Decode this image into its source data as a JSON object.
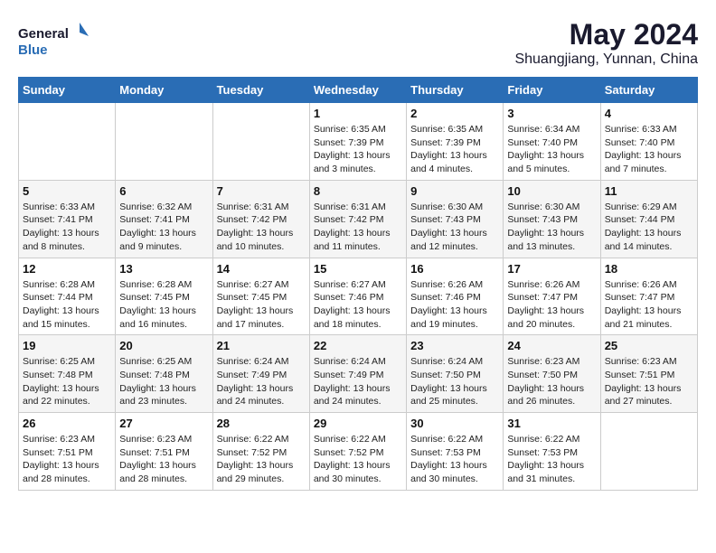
{
  "header": {
    "logo_line1": "General",
    "logo_line2": "Blue",
    "month_year": "May 2024",
    "location": "Shuangjiang, Yunnan, China"
  },
  "days_of_week": [
    "Sunday",
    "Monday",
    "Tuesday",
    "Wednesday",
    "Thursday",
    "Friday",
    "Saturday"
  ],
  "weeks": [
    [
      {
        "day": "",
        "info": ""
      },
      {
        "day": "",
        "info": ""
      },
      {
        "day": "",
        "info": ""
      },
      {
        "day": "1",
        "info": "Sunrise: 6:35 AM\nSunset: 7:39 PM\nDaylight: 13 hours and 3 minutes."
      },
      {
        "day": "2",
        "info": "Sunrise: 6:35 AM\nSunset: 7:39 PM\nDaylight: 13 hours and 4 minutes."
      },
      {
        "day": "3",
        "info": "Sunrise: 6:34 AM\nSunset: 7:40 PM\nDaylight: 13 hours and 5 minutes."
      },
      {
        "day": "4",
        "info": "Sunrise: 6:33 AM\nSunset: 7:40 PM\nDaylight: 13 hours and 7 minutes."
      }
    ],
    [
      {
        "day": "5",
        "info": "Sunrise: 6:33 AM\nSunset: 7:41 PM\nDaylight: 13 hours and 8 minutes."
      },
      {
        "day": "6",
        "info": "Sunrise: 6:32 AM\nSunset: 7:41 PM\nDaylight: 13 hours and 9 minutes."
      },
      {
        "day": "7",
        "info": "Sunrise: 6:31 AM\nSunset: 7:42 PM\nDaylight: 13 hours and 10 minutes."
      },
      {
        "day": "8",
        "info": "Sunrise: 6:31 AM\nSunset: 7:42 PM\nDaylight: 13 hours and 11 minutes."
      },
      {
        "day": "9",
        "info": "Sunrise: 6:30 AM\nSunset: 7:43 PM\nDaylight: 13 hours and 12 minutes."
      },
      {
        "day": "10",
        "info": "Sunrise: 6:30 AM\nSunset: 7:43 PM\nDaylight: 13 hours and 13 minutes."
      },
      {
        "day": "11",
        "info": "Sunrise: 6:29 AM\nSunset: 7:44 PM\nDaylight: 13 hours and 14 minutes."
      }
    ],
    [
      {
        "day": "12",
        "info": "Sunrise: 6:28 AM\nSunset: 7:44 PM\nDaylight: 13 hours and 15 minutes."
      },
      {
        "day": "13",
        "info": "Sunrise: 6:28 AM\nSunset: 7:45 PM\nDaylight: 13 hours and 16 minutes."
      },
      {
        "day": "14",
        "info": "Sunrise: 6:27 AM\nSunset: 7:45 PM\nDaylight: 13 hours and 17 minutes."
      },
      {
        "day": "15",
        "info": "Sunrise: 6:27 AM\nSunset: 7:46 PM\nDaylight: 13 hours and 18 minutes."
      },
      {
        "day": "16",
        "info": "Sunrise: 6:26 AM\nSunset: 7:46 PM\nDaylight: 13 hours and 19 minutes."
      },
      {
        "day": "17",
        "info": "Sunrise: 6:26 AM\nSunset: 7:47 PM\nDaylight: 13 hours and 20 minutes."
      },
      {
        "day": "18",
        "info": "Sunrise: 6:26 AM\nSunset: 7:47 PM\nDaylight: 13 hours and 21 minutes."
      }
    ],
    [
      {
        "day": "19",
        "info": "Sunrise: 6:25 AM\nSunset: 7:48 PM\nDaylight: 13 hours and 22 minutes."
      },
      {
        "day": "20",
        "info": "Sunrise: 6:25 AM\nSunset: 7:48 PM\nDaylight: 13 hours and 23 minutes."
      },
      {
        "day": "21",
        "info": "Sunrise: 6:24 AM\nSunset: 7:49 PM\nDaylight: 13 hours and 24 minutes."
      },
      {
        "day": "22",
        "info": "Sunrise: 6:24 AM\nSunset: 7:49 PM\nDaylight: 13 hours and 24 minutes."
      },
      {
        "day": "23",
        "info": "Sunrise: 6:24 AM\nSunset: 7:50 PM\nDaylight: 13 hours and 25 minutes."
      },
      {
        "day": "24",
        "info": "Sunrise: 6:23 AM\nSunset: 7:50 PM\nDaylight: 13 hours and 26 minutes."
      },
      {
        "day": "25",
        "info": "Sunrise: 6:23 AM\nSunset: 7:51 PM\nDaylight: 13 hours and 27 minutes."
      }
    ],
    [
      {
        "day": "26",
        "info": "Sunrise: 6:23 AM\nSunset: 7:51 PM\nDaylight: 13 hours and 28 minutes."
      },
      {
        "day": "27",
        "info": "Sunrise: 6:23 AM\nSunset: 7:51 PM\nDaylight: 13 hours and 28 minutes."
      },
      {
        "day": "28",
        "info": "Sunrise: 6:22 AM\nSunset: 7:52 PM\nDaylight: 13 hours and 29 minutes."
      },
      {
        "day": "29",
        "info": "Sunrise: 6:22 AM\nSunset: 7:52 PM\nDaylight: 13 hours and 30 minutes."
      },
      {
        "day": "30",
        "info": "Sunrise: 6:22 AM\nSunset: 7:53 PM\nDaylight: 13 hours and 30 minutes."
      },
      {
        "day": "31",
        "info": "Sunrise: 6:22 AM\nSunset: 7:53 PM\nDaylight: 13 hours and 31 minutes."
      },
      {
        "day": "",
        "info": ""
      }
    ]
  ]
}
